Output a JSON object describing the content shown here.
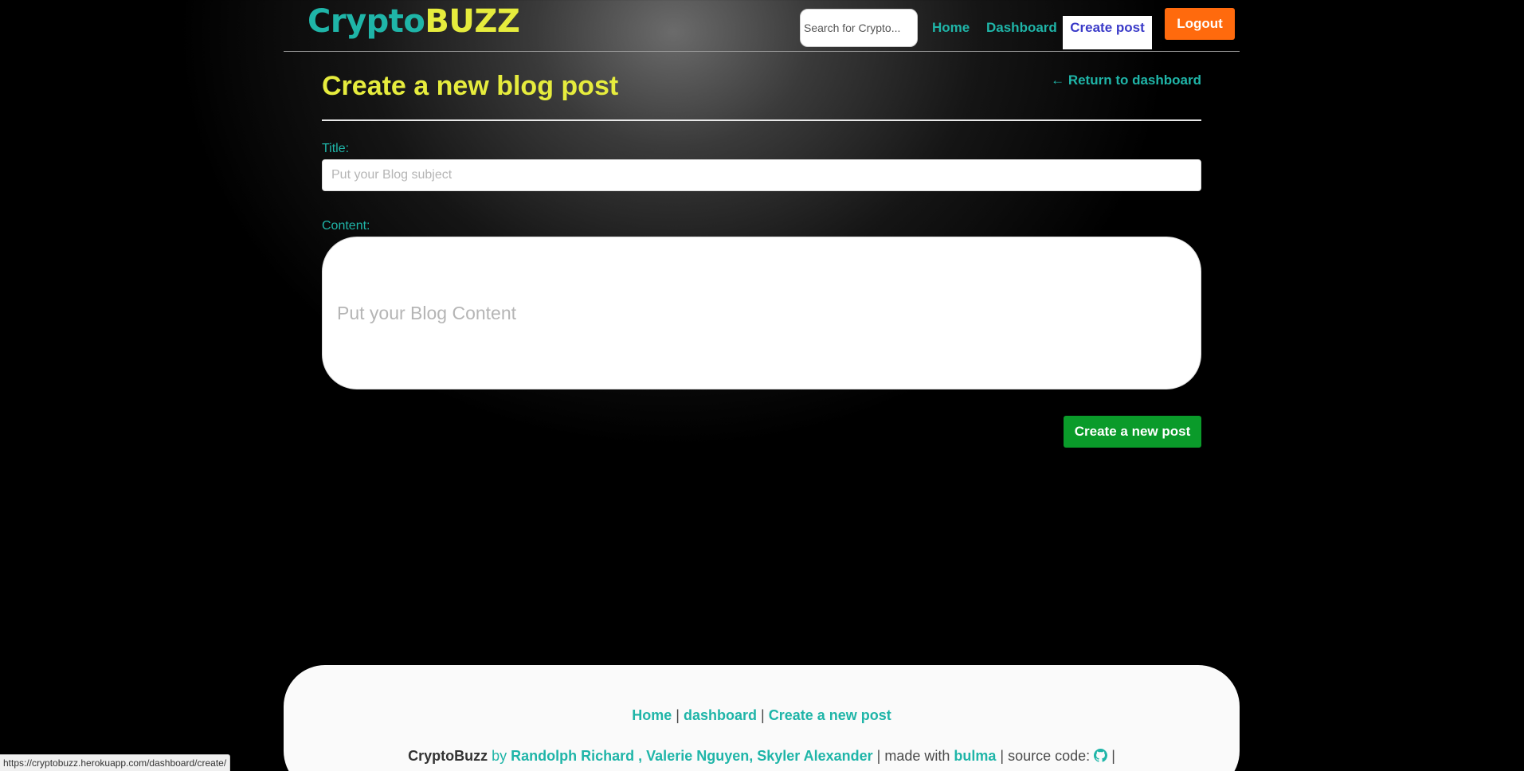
{
  "navbar": {
    "brand_part1": "Crypto",
    "brand_part2": "BUZZ",
    "search_placeholder": "Search for Crypto...",
    "links": {
      "home": "Home",
      "dashboard": "Dashboard",
      "create_post": "Create post"
    },
    "logout_label": "Logout"
  },
  "main": {
    "page_title": "Create a new blog post",
    "return_link": "← Return to dashboard",
    "title_label": "Title:",
    "title_placeholder": "Put your Blog subject",
    "title_value": "",
    "content_label": "Content:",
    "content_placeholder": "Put your Blog Content",
    "content_value": "",
    "submit_label": "Create a new post"
  },
  "footer": {
    "links": {
      "home": "Home",
      "dashboard": "dashboard",
      "create": "Create a new post"
    },
    "separator": "|",
    "brand_name": "CryptoBuzz",
    "by_text": "by",
    "authors": "Randolph Richard , Valerie Nguyen, Skyler Alexander",
    "made_with_text": "| made with",
    "framework": "bulma",
    "source_code_text": "| source code:",
    "trailing_sep": "|",
    "source_icon": "github-icon"
  },
  "status_bar": {
    "url": "https://cryptobuzz.herokuapp.com/dashboard/create/"
  },
  "colors": {
    "accent_teal": "#1fb5a8",
    "title_yellow": "#e6ec3d",
    "logout_orange": "#ff6a0d",
    "submit_green": "#0a9b2a",
    "active_nav_text": "#3a3ac8"
  }
}
